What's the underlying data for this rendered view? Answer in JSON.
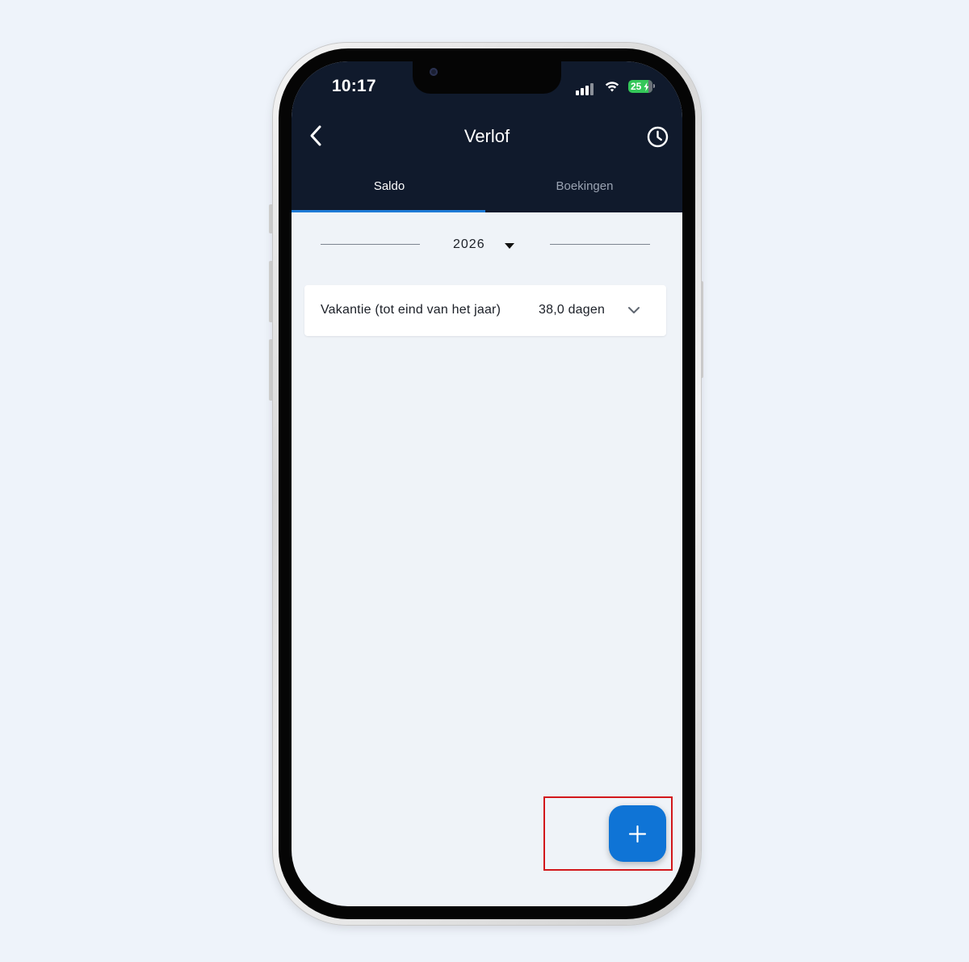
{
  "status_bar": {
    "time": "10:17",
    "battery": "25"
  },
  "header": {
    "title": "Verlof",
    "back_icon": "chevron-left-icon",
    "history_icon": "clock-icon"
  },
  "tabs": [
    {
      "label": "Saldo",
      "active": true
    },
    {
      "label": "Boekingen",
      "active": false
    }
  ],
  "year_selector": {
    "value": "2026"
  },
  "balances": [
    {
      "label": "Vakantie (tot eind van het jaar)",
      "value": "38,0 dagen"
    }
  ],
  "fab": {
    "icon": "plus-icon"
  },
  "colors": {
    "header_bg": "#101a2c",
    "accent": "#1e7ad6",
    "fab": "#0f74d6",
    "screen_bg": "#eff3f8",
    "highlight": "#d2171b"
  }
}
